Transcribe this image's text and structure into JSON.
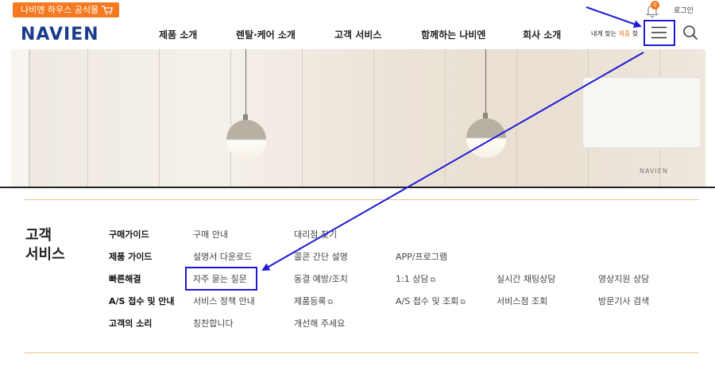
{
  "topbar": {
    "shop_label": "나비엔 하우스 공식몰",
    "notification_count": "0",
    "login_label": "로그인"
  },
  "header": {
    "logo": "NAVIEN",
    "nav": [
      "제품 소개",
      "렌탈·케어 소개",
      "고객 서비스",
      "함께하는 나비엔",
      "회사 소개"
    ],
    "custom_prefix": "내게 맞는 ",
    "custom_highlight": "제품",
    "custom_suffix": " 찾"
  },
  "banner": {
    "device_logo": "NAVIEN"
  },
  "customer_service": {
    "title_line1": "고객",
    "title_line2": "서비스",
    "rows": [
      {
        "heading": "구매가이드",
        "links": [
          "구매 안내",
          "대리점 찾기"
        ]
      },
      {
        "heading": "제품 가이드",
        "links": [
          "설명서 다운로드",
          "콜콘 간단 설명",
          "APP/프로그램"
        ]
      },
      {
        "heading": "빠른해결",
        "links": [
          "자주 묻는 질문",
          "동결 예방/조치",
          "1:1 상담",
          "실시간 채팅상담",
          "영상지원 상담"
        ]
      },
      {
        "heading": "A/S 접수 및 안내",
        "links": [
          "서비스 정책 안내",
          "제품등록",
          "A/S 접수 및 조회",
          "서비스점 조회",
          "방문기사 검색"
        ]
      },
      {
        "heading": "고객의 소리",
        "links": [
          "칭찬합니다",
          "개선해 주세요"
        ]
      }
    ]
  },
  "colors": {
    "brand_blue": "#1a3c8c",
    "accent_orange": "#f47920",
    "annotation_blue": "#1d1bd6",
    "rule_gold": "#e2c58f"
  }
}
